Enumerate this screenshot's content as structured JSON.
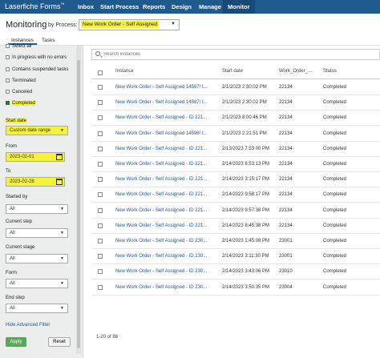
{
  "header": {
    "brand": "Laserfiche Forms",
    "brand_tm": "™",
    "nav": [
      "Inbox",
      "Start Process",
      "Reports",
      "Design",
      "Manage",
      "Monitor"
    ]
  },
  "page": {
    "title": "Monitoring",
    "by_process_label": "by Process:",
    "process_value": "New Work Order - Self Assigned"
  },
  "tabs": [
    "Instances",
    "Tasks"
  ],
  "filters": {
    "status": [
      {
        "label": "Select all",
        "checked": false
      },
      {
        "label": "In progress with no errors",
        "checked": false
      },
      {
        "label": "Contains suspended tasks",
        "checked": false
      },
      {
        "label": "Terminated",
        "checked": false
      },
      {
        "label": "Canceled",
        "checked": false
      },
      {
        "label": "Completed",
        "checked": true
      }
    ],
    "start_date_label": "Start date",
    "start_date_value": "Custom date range",
    "from_label": "From",
    "from_value": "2023-02-01",
    "to_label": "To",
    "to_value": "2023-02-28",
    "started_by_label": "Started by",
    "started_by_value": "All",
    "current_step_label": "Current step",
    "current_step_value": "All",
    "current_stage_label": "Current stage",
    "current_stage_value": "All",
    "form_label": "Form",
    "form_value": "All",
    "end_step_label": "End step",
    "end_step_value": "All",
    "hide_link": "Hide Advanced Filter",
    "apply": "Apply",
    "reset": "Reset"
  },
  "search": {
    "placeholder": "Search instances"
  },
  "table": {
    "columns": [
      "Instance",
      "Start date",
      "Work_Order_...",
      "Status"
    ],
    "rows": [
      [
        "New Work Order - Self Assigned 14587! t...",
        "2/1/2023 2:30:02 PM",
        "22134",
        "Completed"
      ],
      [
        "New Work Order - Self Assigned 14587! t...",
        "2/1/2023 2:30:02 PM",
        "22134",
        "Completed"
      ],
      [
        "New Work Order - Self Assigned - ID 221...",
        "2/1/2023 8:00:46 PM",
        "22134",
        "Completed"
      ],
      [
        "New Work Order - Self Assigned 14596! t...",
        "2/1/2023 2:21:51 PM",
        "22134",
        "Completed"
      ],
      [
        "New Work Order - Self Assigned - ID 221...",
        "2/13/2023 7:53:00 PM",
        "22134",
        "Completed"
      ],
      [
        "New Work Order - Self Assigned - ID 221...",
        "2/14/2023 8:53:13 PM",
        "22134",
        "Completed"
      ],
      [
        "New Work Order - Self Assigned - ID 221...",
        "2/14/2023 3:15:17 PM",
        "22134",
        "Completed"
      ],
      [
        "New Work Order - Self Assigned - ID 221...",
        "2/14/2023 9:58:17 PM",
        "22134",
        "Completed"
      ],
      [
        "New Work Order - Self Assigned - ID 221...",
        "2/14/2023 9:57:38 PM",
        "22134",
        "Completed"
      ],
      [
        "New Work Order - Self Assigned - ID 221...",
        "2/14/2023 8:45:38 PM",
        "22134",
        "Completed"
      ],
      [
        "New Work Order - Self Assigned - ID 230...",
        "2/14/2023 1:45:08 PM",
        "23001",
        "Completed"
      ],
      [
        "New Work Order - Self Assigned - ID 230...",
        "2/14/2023 3:11:30 PM",
        "23001",
        "Completed"
      ],
      [
        "New Work Order - Self Assigned - ID 230...",
        "2/14/2023 3:43:06 PM",
        "23010",
        "Completed"
      ],
      [
        "New Work Order - Self Assigned - ID 230...",
        "2/14/2023 3:50:35 PM",
        "23004",
        "Completed"
      ]
    ],
    "pagination": "1-20 of 86"
  },
  "colors": {
    "nav_bg": "#1e5a8e",
    "highlight": "#f6f13a",
    "apply_bg": "#5aa65a"
  }
}
